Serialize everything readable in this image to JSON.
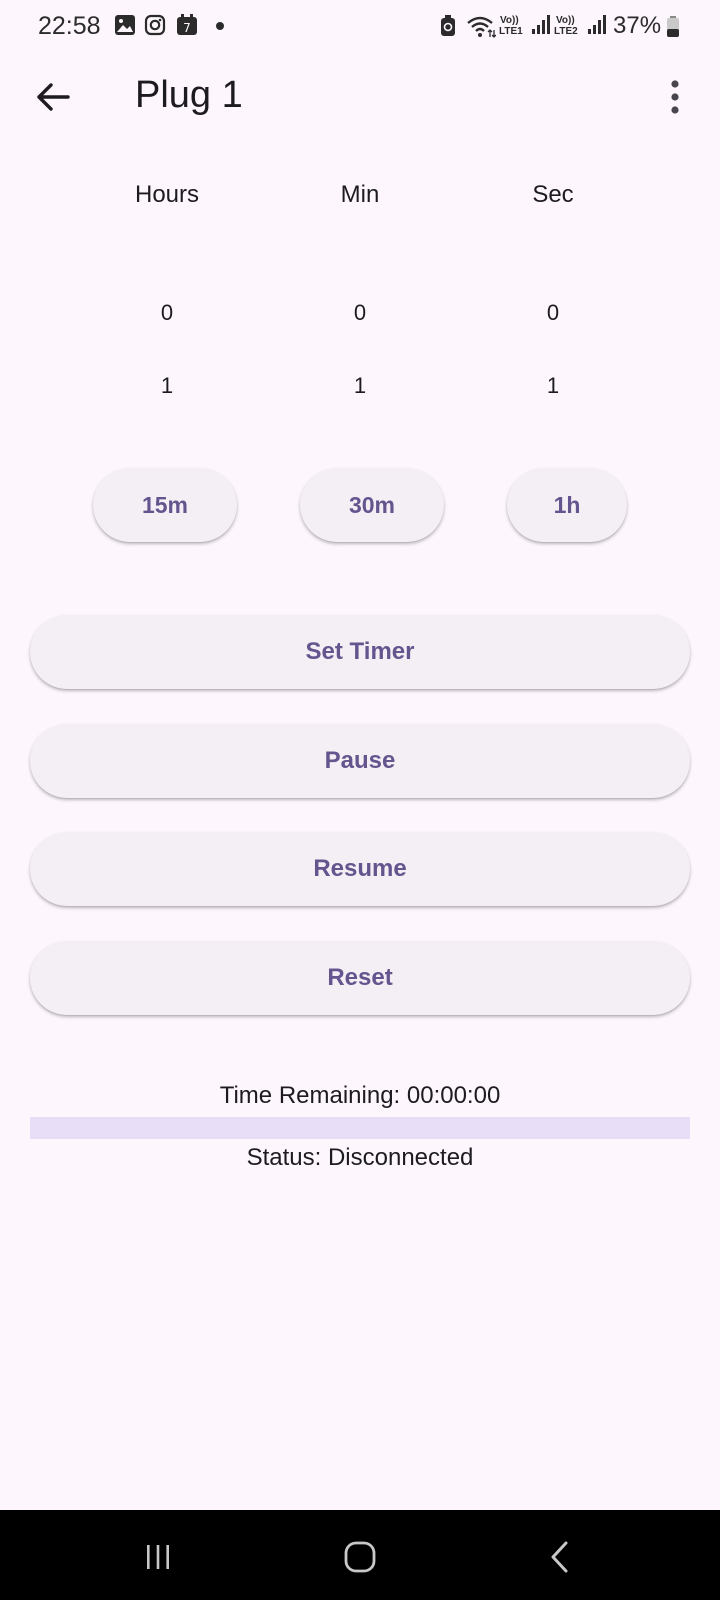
{
  "status_bar": {
    "time": "22:58",
    "battery": "37%",
    "sim1_top": "Vo))",
    "sim1_bottom": "LTE1",
    "sim2_top": "Vo))",
    "sim2_bottom": "LTE2",
    "calendar_day": "7",
    "notification_icons": [
      "gallery-icon",
      "instagram-icon",
      "calendar-icon"
    ]
  },
  "app_bar": {
    "title": "Plug 1"
  },
  "picker": {
    "columns": [
      {
        "label": "Hours",
        "values": [
          "0",
          "1"
        ]
      },
      {
        "label": "Min",
        "values": [
          "0",
          "1"
        ]
      },
      {
        "label": "Sec",
        "values": [
          "0",
          "1"
        ]
      }
    ]
  },
  "presets": [
    "15m",
    "30m",
    "1h"
  ],
  "actions": {
    "set_timer": "Set Timer",
    "pause": "Pause",
    "resume": "Resume",
    "reset": "Reset"
  },
  "timer": {
    "remaining_label": "Time Remaining: 00:00:00",
    "progress": 0,
    "status_label": "Status: Disconnected"
  },
  "colors": {
    "background": "#fdf7fd",
    "accent": "#65558f",
    "button_surface": "#f4eff4",
    "progress_track": "#e8def8"
  }
}
